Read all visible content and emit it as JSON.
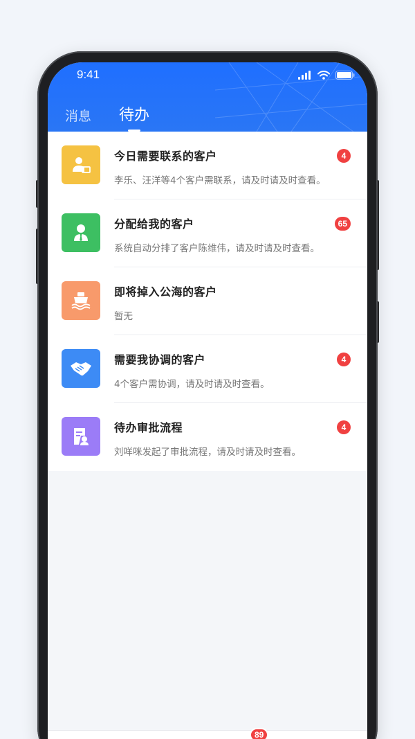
{
  "status_bar": {
    "time": "9:41"
  },
  "tabs": [
    {
      "label": "消息",
      "active": false
    },
    {
      "label": "待办",
      "active": true
    }
  ],
  "items": [
    {
      "title": "今日需要联系的客户",
      "desc": "李乐、汪洋等4个客户需联系，请及时请及时查看。",
      "badge": "4",
      "icon": "contact-card-icon",
      "color": "#f5c242"
    },
    {
      "title": "分配给我的客户",
      "desc": "系统自动分排了客户陈维伟，请及时请及时查看。",
      "badge": "65",
      "icon": "person-tie-icon",
      "color": "#3dbf62"
    },
    {
      "title": "即将掉入公海的客户",
      "desc": "暂无",
      "badge": "",
      "icon": "ship-icon",
      "color": "#f89a6b"
    },
    {
      "title": "需要我协调的客户",
      "desc": "4个客户需协调，请及时请及时查看。",
      "badge": "4",
      "icon": "handshake-icon",
      "color": "#3d8bf5"
    },
    {
      "title": "待办审批流程",
      "desc": "刘咩咪发起了审批流程，请及时请及时查看。",
      "badge": "4",
      "icon": "approval-doc-icon",
      "color": "#9b7cf7"
    }
  ],
  "tabbar": {
    "messages_badge": "89"
  }
}
